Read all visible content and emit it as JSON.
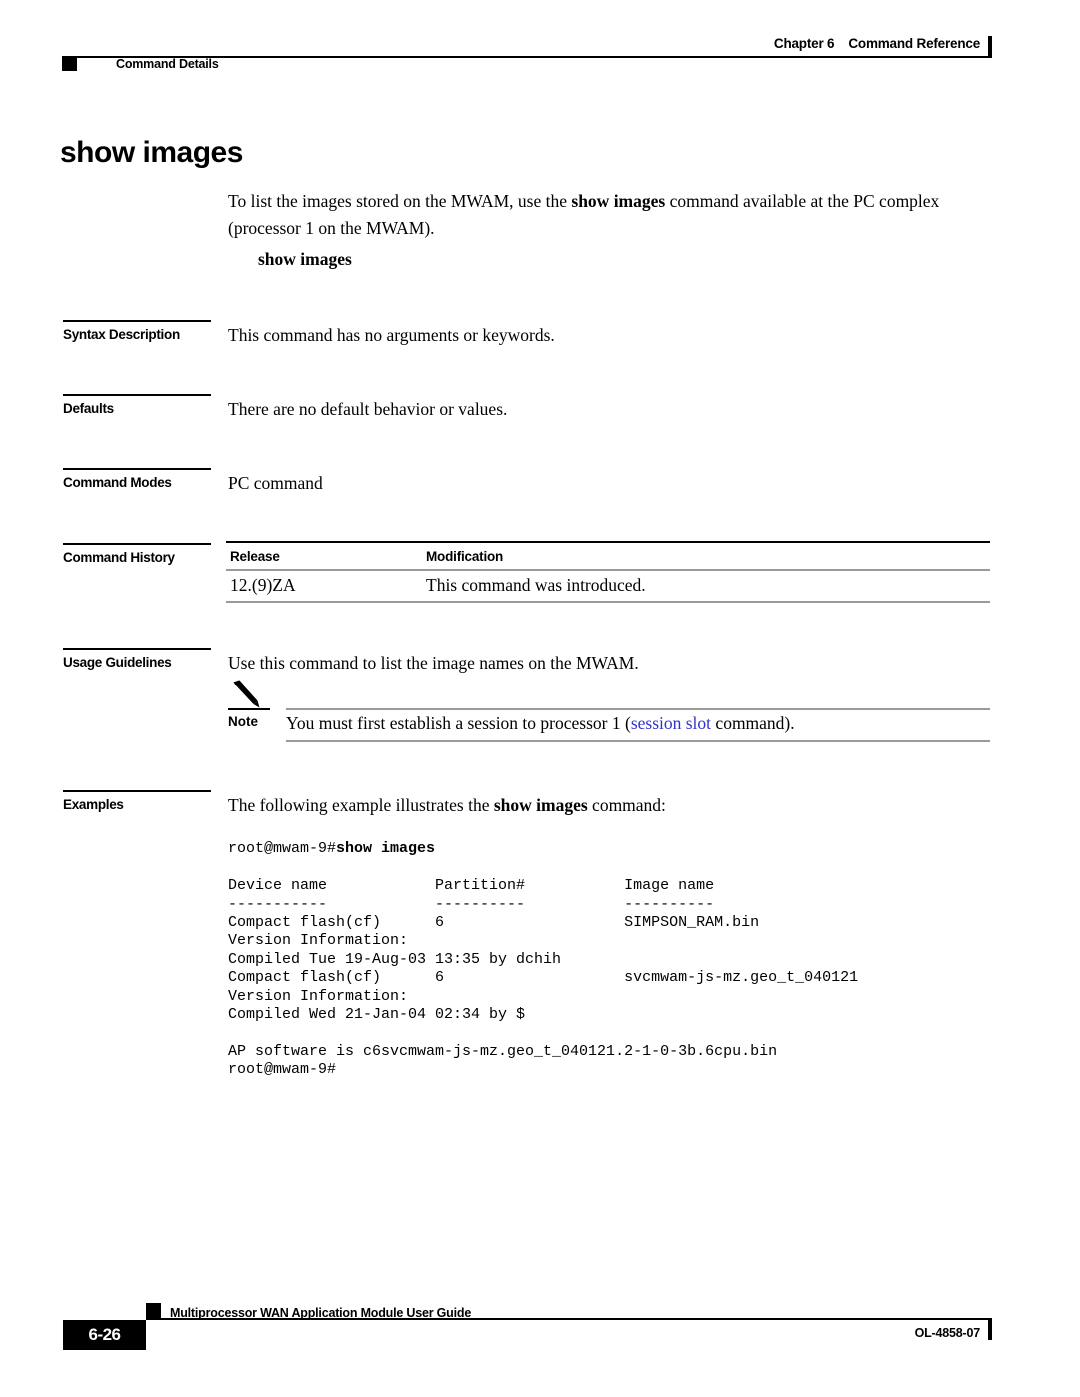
{
  "header": {
    "chapter": "Chapter 6",
    "chapter_title": "Command Reference",
    "section": "Command Details"
  },
  "command": {
    "title": "show images",
    "intro_before": "To list the images stored on the MWAM, use the ",
    "intro_bold": "show images",
    "intro_after": " command available at the PC complex (processor 1 on the MWAM).",
    "syntax_line": "show images"
  },
  "sections": {
    "syntax_description": {
      "label": "Syntax Description",
      "text": "This command has no arguments or keywords."
    },
    "defaults": {
      "label": "Defaults",
      "text": "There are no default behavior or values."
    },
    "command_modes": {
      "label": "Command Modes",
      "text": "PC command"
    },
    "command_history": {
      "label": "Command History",
      "columns": [
        "Release",
        "Modification"
      ],
      "rows": [
        [
          "12.(9)ZA",
          "This command was introduced."
        ]
      ]
    },
    "usage_guidelines": {
      "label": "Usage Guidelines",
      "text": "Use this command to list the image names on the MWAM."
    },
    "examples": {
      "label": "Examples",
      "intro_before": "The following example illustrates the ",
      "intro_bold": "show images",
      "intro_after": " command:"
    }
  },
  "note": {
    "icon": "pencil-icon",
    "label": "Note",
    "text_before": "You must first establish a session to processor 1 (",
    "link_text": "session slot",
    "text_after": " command)."
  },
  "code_example": {
    "prompt": "root@mwam-9#",
    "command": "show images",
    "lines": [
      "Device name            Partition#           Image name",
      "-----------            ----------           ----------",
      "Compact flash(cf)      6                    SIMPSON_RAM.bin",
      "Version Information:",
      "Compiled Tue 19-Aug-03 13:35 by dchih",
      "Compact flash(cf)      6                    svcmwam-js-mz.geo_t_040121",
      "Version Information:",
      "Compiled Wed 21-Jan-04 02:34 by $",
      "",
      "AP software is c6svcmwam-js-mz.geo_t_040121.2-1-0-3b.6cpu.bin",
      "root@mwam-9#"
    ]
  },
  "footer": {
    "page_number": "6-26",
    "doc_title": "Multiprocessor WAN Application Module User Guide",
    "doc_id": "OL-4858-07"
  }
}
